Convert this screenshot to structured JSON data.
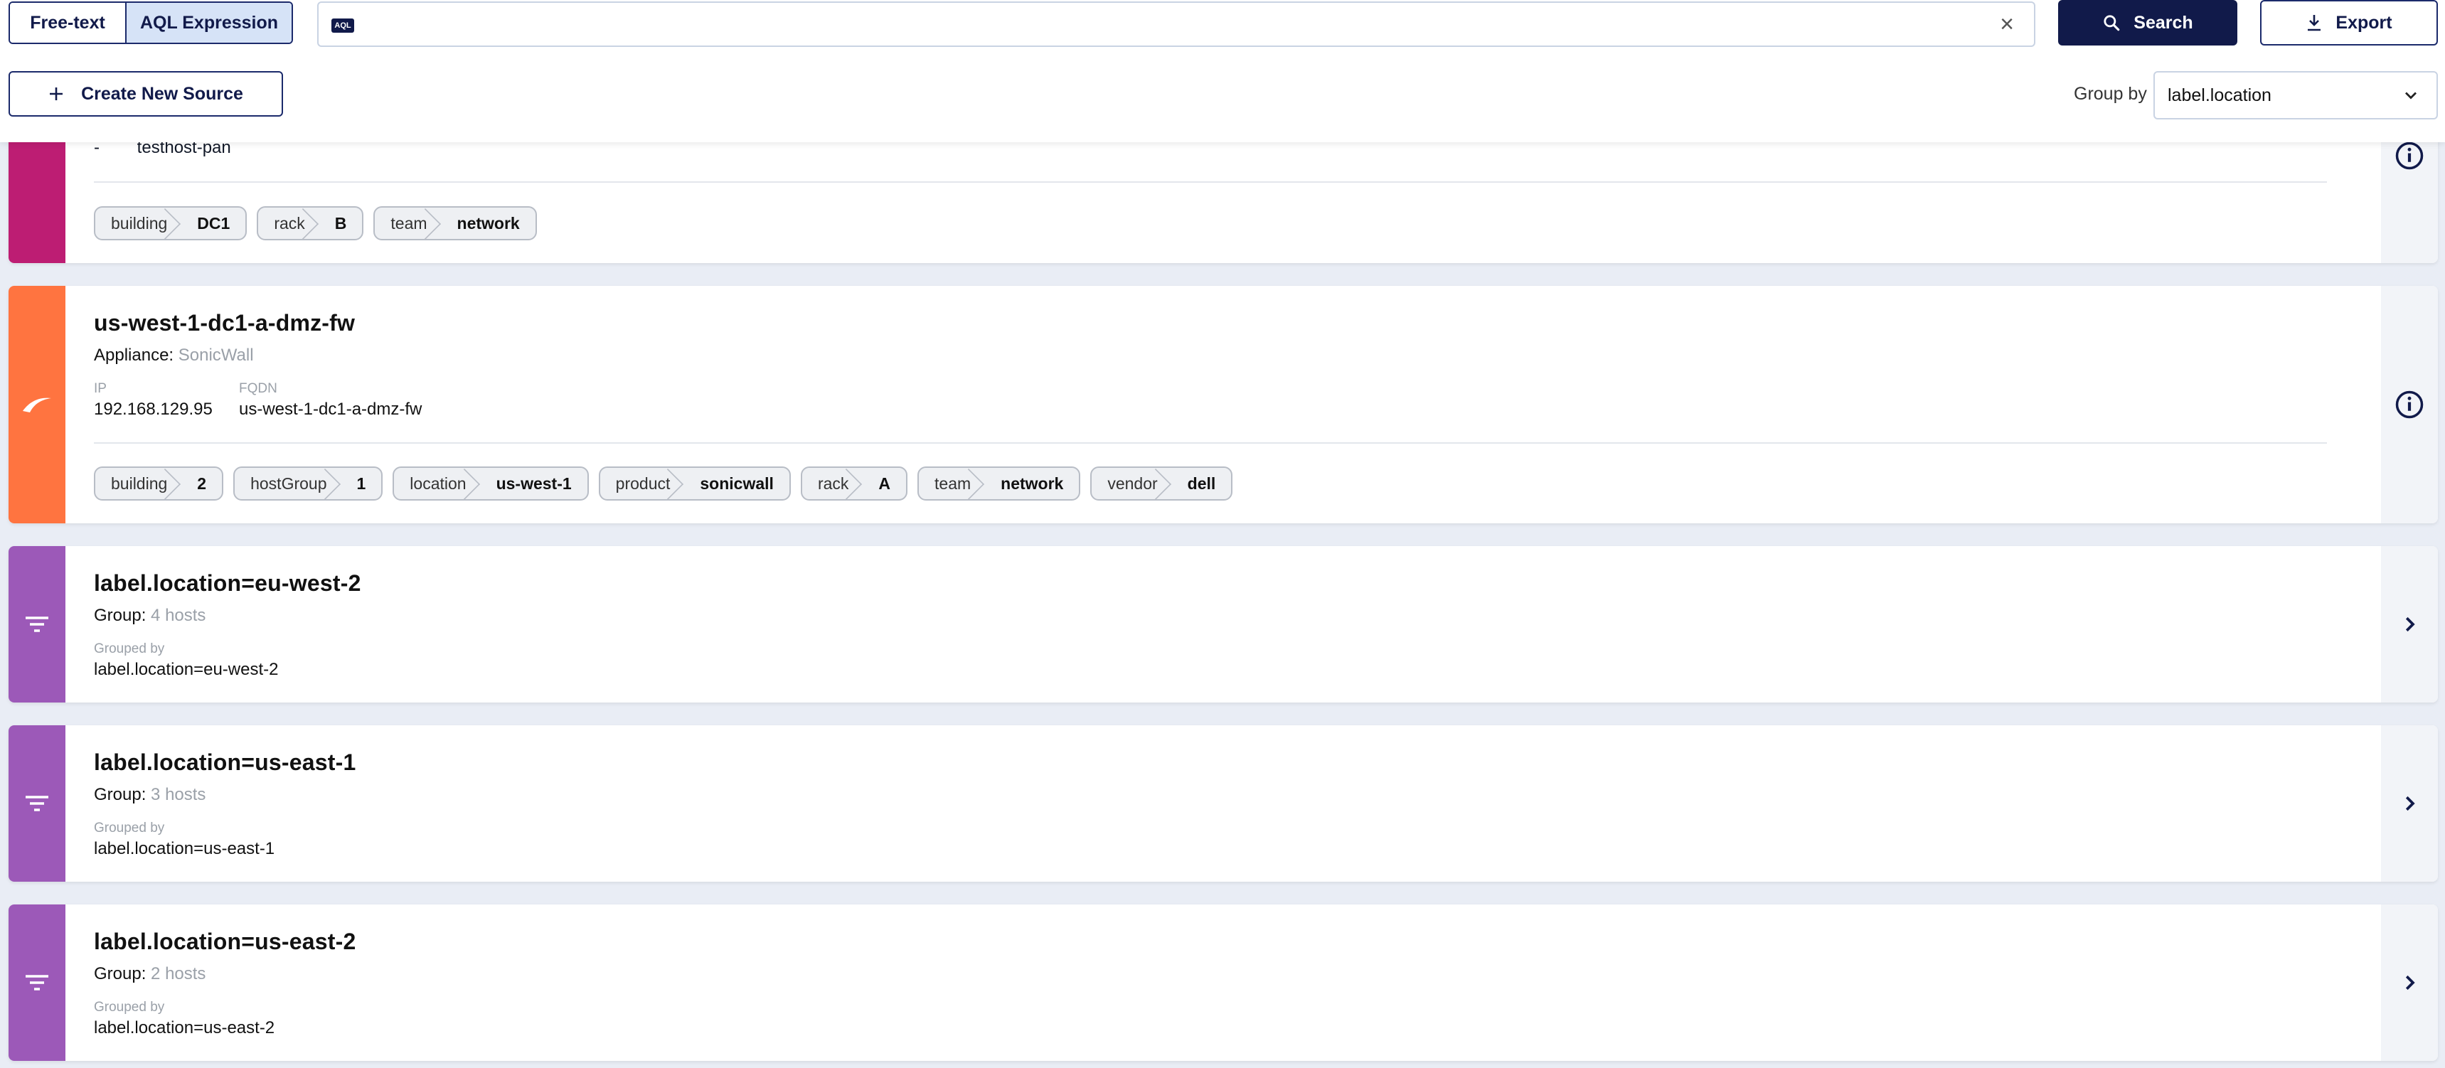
{
  "toolbar": {
    "mode_freetext": "Free-text",
    "mode_aql": "AQL Expression",
    "aql_badge": "AQL",
    "query_value": "",
    "search_label": "Search",
    "export_label": "Export",
    "create_label": "Create New Source",
    "group_by_label": "Group by",
    "group_by_value": "label.location"
  },
  "colors": {
    "accent": "#111a4a",
    "magenta": "#bd1d73",
    "orange": "#ff7440",
    "purple": "#9c59b8"
  },
  "partial_card": {
    "row_dash": "-",
    "row_value": "testhost-pan",
    "tags": [
      {
        "k": "building",
        "v": "DC1"
      },
      {
        "k": "rack",
        "v": "B"
      },
      {
        "k": "team",
        "v": "network"
      }
    ]
  },
  "host_card": {
    "name": "us-west-1-dc1-a-dmz-fw",
    "appliance_label": "Appliance:",
    "appliance_value": "SonicWall",
    "ip_label": "IP",
    "ip_value": "192.168.129.95",
    "fqdn_label": "FQDN",
    "fqdn_value": "us-west-1-dc1-a-dmz-fw",
    "tags": [
      {
        "k": "building",
        "v": "2"
      },
      {
        "k": "hostGroup",
        "v": "1"
      },
      {
        "k": "location",
        "v": "us-west-1"
      },
      {
        "k": "product",
        "v": "sonicwall"
      },
      {
        "k": "rack",
        "v": "A"
      },
      {
        "k": "team",
        "v": "network"
      },
      {
        "k": "vendor",
        "v": "dell"
      }
    ]
  },
  "groups": [
    {
      "title": "label.location=eu-west-2",
      "group_label": "Group:",
      "count": "4 hosts",
      "grouped_by_label": "Grouped by",
      "grouped_by_value": "label.location=eu-west-2"
    },
    {
      "title": "label.location=us-east-1",
      "group_label": "Group:",
      "count": "3 hosts",
      "grouped_by_label": "Grouped by",
      "grouped_by_value": "label.location=us-east-1"
    },
    {
      "title": "label.location=us-east-2",
      "group_label": "Group:",
      "count": "2 hosts",
      "grouped_by_label": "Grouped by",
      "grouped_by_value": "label.location=us-east-2"
    }
  ]
}
